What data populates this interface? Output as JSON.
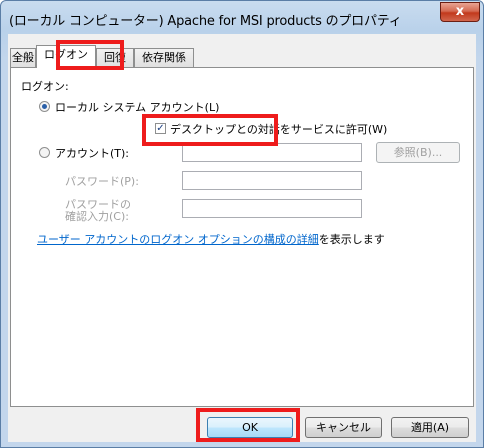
{
  "window": {
    "title": "(ローカル コンピューター) Apache for MSI products のプロパティ",
    "close_glyph": "x"
  },
  "tabs": [
    {
      "label": "全般",
      "active": false
    },
    {
      "label": "ログオン",
      "active": true
    },
    {
      "label": "回復",
      "active": false
    },
    {
      "label": "依存関係",
      "active": false
    }
  ],
  "logon": {
    "section_label": "ログオン:",
    "local_system_label": "ローカル システム アカウント(L)",
    "local_system_selected": true,
    "desktop_interact_label": "デスクトップとの対話をサービスに許可(W)",
    "desktop_interact_checked": true,
    "this_account_label": "アカウント(T):",
    "this_account_selected": false,
    "account_value": "",
    "browse_label": "参照(B)...",
    "password_label": "パスワード(P):",
    "password_value": "",
    "confirm_label_line1": "パスワードの",
    "confirm_label_line2": "確認入力(C):",
    "confirm_value": "",
    "help_link": "ユーザー アカウントのログオン オプションの構成の詳細",
    "help_suffix": "を表示します"
  },
  "buttons": {
    "ok": "OK",
    "cancel": "キャンセル",
    "apply": "適用(A)"
  },
  "colors": {
    "highlight": "#ee1c1c",
    "link": "#0066cc",
    "close_button": "#c2391c"
  }
}
